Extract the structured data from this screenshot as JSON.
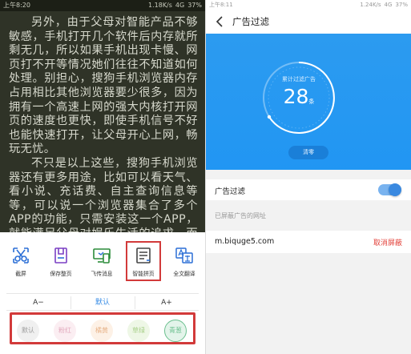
{
  "left": {
    "status_bar": {
      "time": "上午8:20",
      "network": "1.18K/s",
      "signal": "4G",
      "battery": "37%"
    },
    "reader": {
      "paragraphs": [
        "另外，由于父母对智能产品不够敏感，手机打开几个软件后内存就所剩无几，所以如果手机出现卡慢、网页打不开等情况她们往往不知道如何处理。别担心，搜狗手机浏览器内存占用相比其他浏览器要少很多，因为拥有一个高速上网的强大内核打开网页的速度也更快，即使手机信号不好也能快速打开，让父母开心上网，畅玩无忧。",
        "不只是以上这些，搜狗手机浏览器还有更多用途，比如可以看天气、看小说、充话费、自主查询信息等等，可以说一个浏览器集合了多个APP的功能，只需安装这一个APP，就能满足父母对娱乐生活的追求，而且不用在多个APP之间来回"
      ]
    },
    "tools": [
      {
        "label": "截屏",
        "icon": "screenshot-scissors-icon"
      },
      {
        "label": "保存整页",
        "icon": "save-page-icon"
      },
      {
        "label": "飞传消息",
        "icon": "send-message-icon"
      },
      {
        "label": "智能拼页",
        "icon": "smart-merge-page-icon"
      },
      {
        "label": "全文翻译",
        "icon": "translate-icon"
      }
    ],
    "font": {
      "smaller": "A−",
      "current": "默认",
      "larger": "A+"
    },
    "themes": [
      {
        "label": "默认",
        "bg": "#f0f0f0",
        "fg": "#9a9a9a"
      },
      {
        "label": "粉红",
        "bg": "#fbeef2",
        "fg": "#e2a9bd"
      },
      {
        "label": "橘黄",
        "bg": "#fdf1e6",
        "fg": "#e8b48a"
      },
      {
        "label": "草绿",
        "bg": "#eef7e6",
        "fg": "#a7cf88"
      },
      {
        "label": "青葱",
        "bg": "#e3f4ea",
        "fg": "#6cc08f"
      }
    ],
    "highlight_color": "#d23a3a"
  },
  "right": {
    "status_bar": {
      "time": "上午8:11",
      "network": "1.24K/s",
      "signal": "4G",
      "battery": "37%"
    },
    "title": "广告过滤",
    "stat_label": "累计过滤广告",
    "count": "28",
    "count_unit": "条",
    "clear_label": "清零",
    "toggle_label": "广告过滤",
    "toggle_on": true,
    "blocked_header": "已屏蔽广告的网址",
    "sites": [
      {
        "url": "m.biquge5.com",
        "action": "取消屏蔽"
      }
    ],
    "accent": "#2196f3",
    "danger": "#e3443d"
  }
}
